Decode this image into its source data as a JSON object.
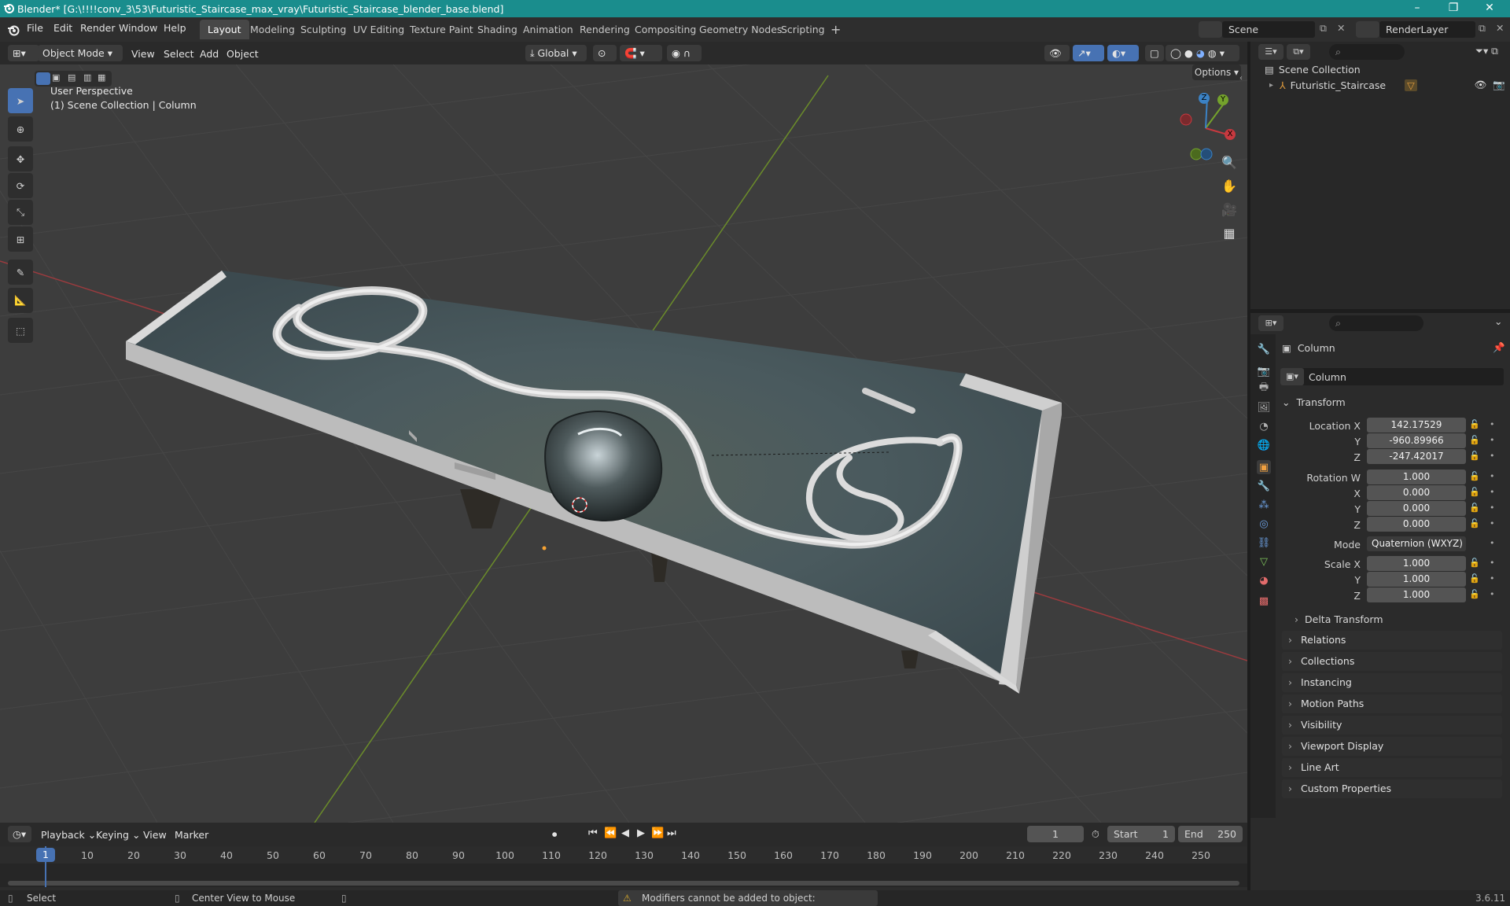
{
  "title_bar": {
    "title": "Blender* [G:\\!!!!conv_3\\53\\Futuristic_Staircase_max_vray\\Futuristic_Staircase_blender_base.blend]"
  },
  "menu": {
    "items": [
      "File",
      "Edit",
      "Render",
      "Window",
      "Help"
    ]
  },
  "workspaces": [
    "Layout",
    "Modeling",
    "Sculpting",
    "UV Editing",
    "Texture Paint",
    "Shading",
    "Animation",
    "Rendering",
    "Compositing",
    "Geometry Nodes",
    "Scripting"
  ],
  "active_workspace": "Layout",
  "scene": {
    "label": "Scene",
    "render_layer": "RenderLayer"
  },
  "viewport_header": {
    "mode": "Object Mode",
    "menus": [
      "View",
      "Select",
      "Add",
      "Object"
    ],
    "transform_orientation": "Global",
    "options_label": "Options"
  },
  "viewport": {
    "perspective_label": "User Perspective",
    "collection_label": "(1) Scene Collection | Column",
    "gizmo_labels": {
      "x": "X",
      "y": "Y",
      "z": "Z"
    }
  },
  "outliner": {
    "root": "Scene Collection",
    "items": [
      {
        "label": "Futuristic_Staircase"
      }
    ]
  },
  "properties": {
    "object_name": "Column",
    "data_name": "Column",
    "transform_label": "Transform",
    "location": {
      "label": "Location X",
      "x": "142.17529",
      "y": "-960.89966",
      "z": "-247.42017"
    },
    "rotation": {
      "label": "Rotation W",
      "w": "1.000",
      "x": "0.000",
      "y": "0.000",
      "z": "0.000"
    },
    "mode_label": "Mode",
    "mode_value": "Quaternion (WXYZ)",
    "scale": {
      "label": "Scale X",
      "x": "1.000",
      "y": "1.000",
      "z": "1.000"
    },
    "axis_labels": {
      "y": "Y",
      "z": "Z",
      "x": "X"
    },
    "delta_transform": "Delta Transform",
    "panels": [
      "Relations",
      "Collections",
      "Instancing",
      "Motion Paths",
      "Visibility",
      "Viewport Display",
      "Line Art",
      "Custom Properties"
    ]
  },
  "timeline": {
    "menus": [
      "Playback",
      "Keying",
      "View",
      "Marker"
    ],
    "current_frame": "1",
    "start_label": "Start",
    "start": "1",
    "end_label": "End",
    "end": "250",
    "ticks": [
      "1",
      "10",
      "20",
      "30",
      "40",
      "50",
      "60",
      "70",
      "80",
      "90",
      "100",
      "110",
      "120",
      "130",
      "140",
      "150",
      "160",
      "170",
      "180",
      "190",
      "200",
      "210",
      "220",
      "230",
      "240",
      "250"
    ]
  },
  "status_bar": {
    "left": "Select",
    "middle": "Center View to Mouse",
    "warning": "Modifiers cannot be added to object: Futuristic_Staircase",
    "version": "3.6.11"
  },
  "colors": {
    "accent": "#4772b3",
    "titlebar": "#1a8d8d",
    "x_axis": "#c7393f",
    "y_axis": "#74a22c",
    "z_axis": "#3b82c5",
    "warning": "#d4a72c"
  }
}
